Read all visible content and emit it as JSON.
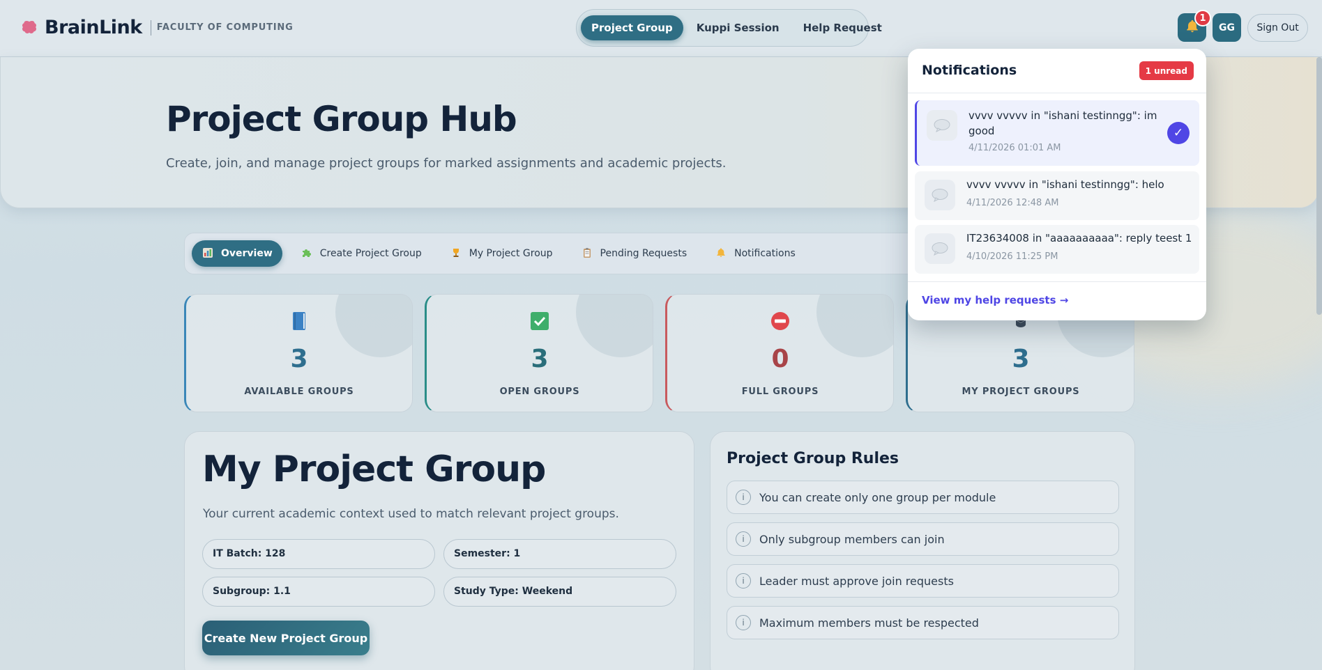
{
  "header": {
    "brand_name": "BrainLink",
    "faculty": "FACULTY OF COMPUTING",
    "nav": [
      {
        "label": "Project Group",
        "active": true
      },
      {
        "label": "Kuppi Session",
        "active": false
      },
      {
        "label": "Help Request",
        "active": false
      }
    ],
    "notification_count": "1",
    "avatar_initials": "GG",
    "sign_out": "Sign Out"
  },
  "hero": {
    "title": "Project Group Hub",
    "subtitle": "Create, join, and manage project groups for marked assignments and academic projects."
  },
  "tabs": [
    {
      "label": "Overview",
      "icon": "chart-icon",
      "active": true
    },
    {
      "label": "Create Project Group",
      "icon": "puzzle-icon",
      "active": false
    },
    {
      "label": "My Project Group",
      "icon": "trophy-icon",
      "active": false
    },
    {
      "label": "Pending Requests",
      "icon": "clipboard-icon",
      "active": false
    },
    {
      "label": "Notifications",
      "icon": "bell-icon",
      "active": false
    }
  ],
  "stats": [
    {
      "value": "3",
      "label": "AVAILABLE GROUPS",
      "icon": "book-icon",
      "color": "#2e6e8e"
    },
    {
      "value": "3",
      "label": "OPEN GROUPS",
      "icon": "checkbox-icon",
      "color": "#2a6e7a"
    },
    {
      "value": "0",
      "label": "FULL GROUPS",
      "icon": "no-entry-icon",
      "color": "#a84448"
    },
    {
      "value": "3",
      "label": "MY PROJECT GROUPS",
      "icon": "graduation-icon",
      "color": "#2e6e8e"
    }
  ],
  "my_group": {
    "title": "My Project Group",
    "description": "Your current academic context used to match relevant project groups.",
    "chips": {
      "batch": "IT Batch: 128",
      "semester": "Semester: 1",
      "subgroup": "Subgroup: 1.1",
      "study_type": "Study Type: Weekend"
    },
    "create_button": "Create New Project Group"
  },
  "rules": {
    "title": "Project Group Rules",
    "items": [
      "You can create only one group per module",
      "Only subgroup members can join",
      "Leader must approve join requests",
      "Maximum members must be respected"
    ]
  },
  "notifications": {
    "title": "Notifications",
    "unread_label": "1 unread",
    "items": [
      {
        "message": "vvvv vvvvv in \"ishani testinngg\": im good",
        "time": "4/11/2026 01:01 AM",
        "unread": true
      },
      {
        "message": "vvvv vvvvv in \"ishani testinngg\": helo",
        "time": "4/11/2026 12:48 AM",
        "unread": false
      },
      {
        "message": "IT23634008 in \"aaaaaaaaaa\": reply teest 1",
        "time": "4/10/2026 11:25 PM",
        "unread": false
      }
    ],
    "footer_link": "View my help requests →"
  },
  "colors": {
    "accent": "#2f6e84",
    "notification_accent": "#4f46e5",
    "badge_red": "#e53a45"
  }
}
